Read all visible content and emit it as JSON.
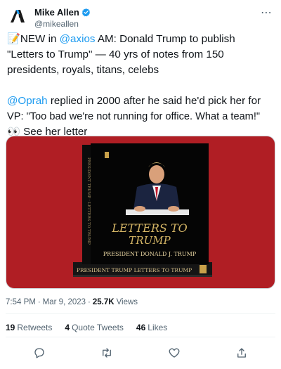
{
  "author": {
    "display_name": "Mike Allen",
    "handle": "@mikeallen",
    "avatar_icon": "axios-logo",
    "verified_color": "#1d9bf0"
  },
  "more_icon": "⋯",
  "tweet": {
    "line1_emoji": "📝",
    "line1_pre": "NEW in ",
    "line1_mention": "@axios",
    "line1_post": " AM: Donald Trump to publish",
    "line2": "\"Letters to Trump\" — 40 yrs of notes from 150",
    "line3": "presidents, royals, titans, celebs",
    "line4_mention": "@Oprah",
    "line4_post": " replied in 2000 after he said he'd pick her for",
    "line5": "VP: \"Too bad we're not running for office. What a team!\"",
    "line6_emoji": "👀",
    "line6_text": " See her letter"
  },
  "media": {
    "background": "#b01e24",
    "book_title_line1": "LETTERS TO",
    "book_title_line2": "TRUMP",
    "book_author": "PRESIDENT DONALD J. TRUMP",
    "spine_text": "PRESIDENT TRUMP   LETTERS TO TRUMP",
    "side_spine_text": "PRESIDENT TRUMP · LETTERS TO TRUMP"
  },
  "meta": {
    "time": "7:54 PM",
    "sep1": "·",
    "date": "Mar 9, 2023",
    "sep2": "·",
    "views_count": "25.7K",
    "views_label": "Views"
  },
  "stats": {
    "retweets_count": "19",
    "retweets_label": "Retweets",
    "quotes_count": "4",
    "quotes_label": "Quote Tweets",
    "likes_count": "46",
    "likes_label": "Likes"
  },
  "actions": [
    "reply-icon",
    "retweet-icon",
    "like-icon",
    "share-icon"
  ],
  "colors": {
    "link": "#1d9bf0",
    "secondary_text": "#536471",
    "primary_text": "#0f1419"
  }
}
